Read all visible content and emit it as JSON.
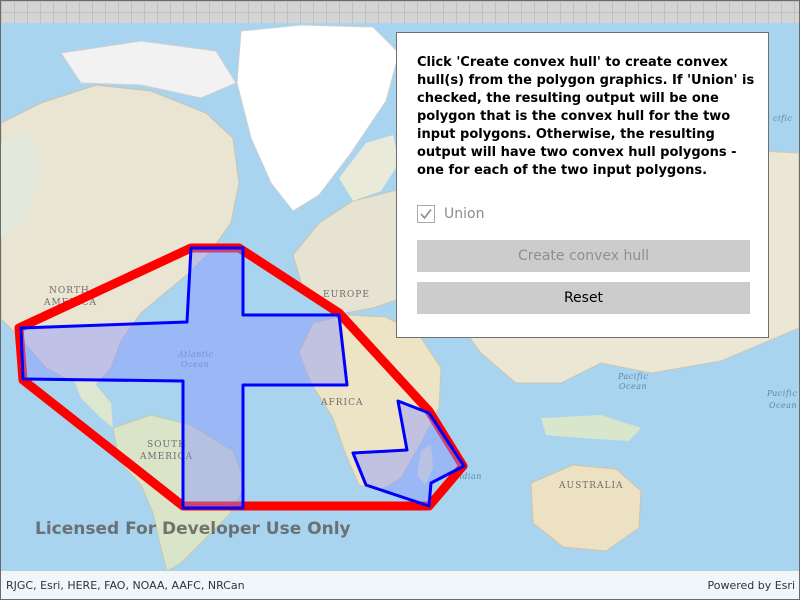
{
  "map": {
    "continent_labels": [
      "NORTH",
      "AMERICA",
      "SOUTH",
      "AMERICA",
      "EUROPE",
      "AFRICA",
      "AUSTRALIA"
    ],
    "ocean_labels": [
      "Atlantic",
      "Ocean",
      "Pacific",
      "Ocean",
      "Pacific",
      "Ocean",
      "Indian",
      "cific"
    ],
    "watermark": "Licensed For Developer Use Only",
    "hull_color": "#ff0000",
    "polygon_outline_color": "#0000ff",
    "polygon_fill_color": "#8c96ff"
  },
  "panel": {
    "instructions": "Click 'Create convex hull' to create convex hull(s) from the polygon graphics. If 'Union' is checked, the resulting output will be one polygon that is the convex hull for the two input polygons. Otherwise, the resulting output will have two convex hull polygons - one for each of the two input polygons.",
    "union_label": "Union",
    "union_checked": true,
    "union_enabled": false,
    "create_button_label": "Create convex hull",
    "create_button_enabled": false,
    "reset_button_label": "Reset"
  },
  "attribution": {
    "sources": "RJGC, Esri, HERE, FAO, NOAA, AAFC, NRCan",
    "powered_by": "Powered by Esri"
  }
}
